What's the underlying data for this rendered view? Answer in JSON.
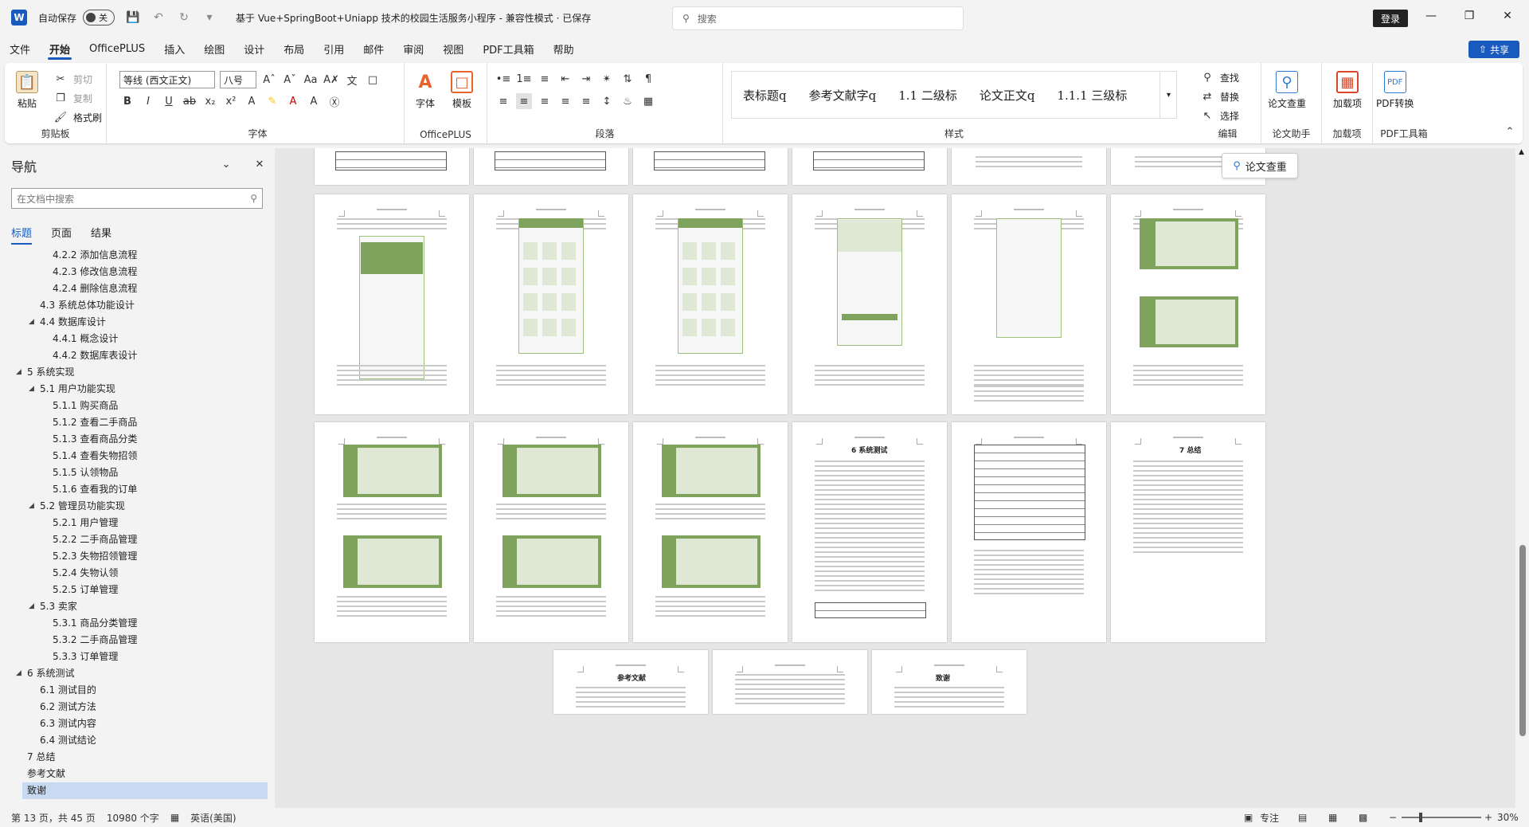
{
  "titlebar": {
    "app_letter": "W",
    "autosave_label": "自动保存",
    "autosave_state": "关",
    "doc_title": "基于 Vue+SpringBoot+Uniapp 技术的校园生活服务小程序  -  兼容性模式 · 已保存",
    "search_placeholder": "搜索",
    "login_label": "登录"
  },
  "menu": {
    "tabs": [
      "文件",
      "开始",
      "OfficePLUS",
      "插入",
      "绘图",
      "设计",
      "布局",
      "引用",
      "邮件",
      "审阅",
      "视图",
      "PDF工具箱",
      "帮助"
    ],
    "active_tab": "开始",
    "share_label": "共享"
  },
  "ribbon": {
    "clipboard": {
      "paste": "粘贴",
      "cut": "剪切",
      "copy": "复制",
      "format_painter": "格式刷",
      "label": "剪贴板"
    },
    "font": {
      "font_name": "等线 (西文正文)",
      "font_size": "八号",
      "label": "字体"
    },
    "officeplus": {
      "font_btn": "字体",
      "template_btn": "模板",
      "label": "OfficePLUS"
    },
    "paragraph": {
      "label": "段落"
    },
    "styles": {
      "items": [
        "表标题q",
        "参考文献字q",
        "1.1  二级标",
        "论文正文q",
        "1.1.1  三级标"
      ],
      "label": "样式"
    },
    "editing": {
      "find": "查找",
      "replace": "替换",
      "select": "选择",
      "label": "编辑"
    },
    "assistant": {
      "check": "论文查重",
      "label": "论文助手"
    },
    "addins": {
      "add": "加载项",
      "label": "加载项"
    },
    "pdf": {
      "convert": "PDF转换",
      "label": "PDF工具箱"
    }
  },
  "nav": {
    "title": "导航",
    "search_placeholder": "在文档中搜索",
    "tabs": [
      "标题",
      "页面",
      "结果"
    ],
    "active_tab": "标题",
    "items": [
      {
        "label": "4.2.2 添加信息流程",
        "level": 3
      },
      {
        "label": "4.2.3 修改信息流程",
        "level": 3
      },
      {
        "label": "4.2.4 删除信息流程",
        "level": 3
      },
      {
        "label": "4.3 系统总体功能设计",
        "level": 2
      },
      {
        "label": "4.4 数据库设计",
        "level": 2,
        "expanded": true
      },
      {
        "label": "4.4.1 概念设计",
        "level": 3
      },
      {
        "label": "4.4.2 数据库表设计",
        "level": 3
      },
      {
        "label": "5 系统实现",
        "level": 1,
        "expanded": true
      },
      {
        "label": "5.1 用户功能实现",
        "level": 2,
        "expanded": true
      },
      {
        "label": "5.1.1 购买商品",
        "level": 3
      },
      {
        "label": "5.1.2 查看二手商品",
        "level": 3
      },
      {
        "label": "5.1.3 查看商品分类",
        "level": 3
      },
      {
        "label": "5.1.4 查看失物招领",
        "level": 3
      },
      {
        "label": "5.1.5 认领物品",
        "level": 3
      },
      {
        "label": "5.1.6 查看我的订单",
        "level": 3
      },
      {
        "label": "5.2 管理员功能实现",
        "level": 2,
        "expanded": true
      },
      {
        "label": "5.2.1 用户管理",
        "level": 3
      },
      {
        "label": "5.2.2 二手商品管理",
        "level": 3
      },
      {
        "label": "5.2.3 失物招领管理",
        "level": 3
      },
      {
        "label": "5.2.4 失物认领",
        "level": 3
      },
      {
        "label": "5.2.5 订单管理",
        "level": 3
      },
      {
        "label": "5.3 卖家",
        "level": 2,
        "expanded": true
      },
      {
        "label": "5.3.1 商品分类管理",
        "level": 3
      },
      {
        "label": "5.3.2 二手商品管理",
        "level": 3
      },
      {
        "label": "5.3.3 订单管理",
        "level": 3
      },
      {
        "label": "6 系统测试",
        "level": 1,
        "expanded": true
      },
      {
        "label": "6.1 测试目的",
        "level": 2
      },
      {
        "label": "6.2 测试方法",
        "level": 2
      },
      {
        "label": "6.3 测试内容",
        "level": 2
      },
      {
        "label": "6.4 测试结论",
        "level": 2
      },
      {
        "label": "7 总结",
        "level": 1
      },
      {
        "label": "参考文献",
        "level": 1
      },
      {
        "label": "致谢",
        "level": 1,
        "selected": true
      }
    ]
  },
  "document": {
    "floating_button": "论文查重",
    "page_headings": {
      "system_test": "6   系统测试",
      "summary": "7  总结",
      "references": "参考文献",
      "thanks": "致谢"
    }
  },
  "status": {
    "page": "第 13 页，共 45 页",
    "words": "10980 个字",
    "language": "英语(美国)",
    "focus": "专注",
    "zoom": "30%"
  },
  "colors": {
    "accent": "#185abd",
    "screenshot_green": "#7fa35d"
  }
}
